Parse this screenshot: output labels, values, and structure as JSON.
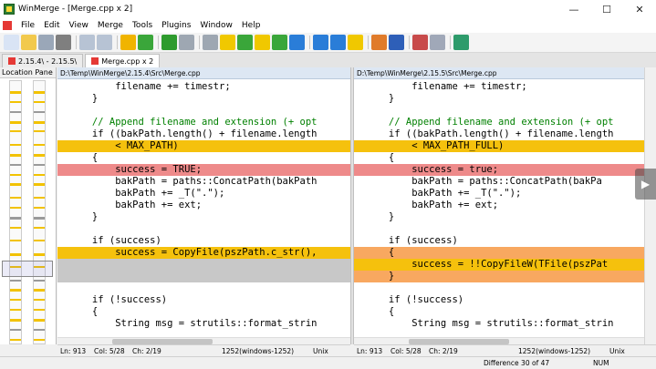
{
  "window": {
    "title": "WinMerge - [Merge.cpp x 2]",
    "minimize": "—",
    "maximize": "☐",
    "close": "✕"
  },
  "menu": [
    "File",
    "Edit",
    "View",
    "Merge",
    "Tools",
    "Plugins",
    "Window",
    "Help"
  ],
  "toolbar": {
    "colors": [
      "#d9e4f5",
      "#f2c94c",
      "#9aa7b8",
      "#7f7f7f",
      "#b7c3d4",
      "#b7c3d4",
      "#f0b400",
      "#3aa63a",
      "#2e9b2e",
      "#9ea7b2",
      "#9ea7b2",
      "#f0c800",
      "#3aa63a",
      "#f0c800",
      "#3aa63a",
      "#2a7dd8",
      "#2a7dd8",
      "#2a7dd8",
      "#f0c800",
      "#e07b2a",
      "#2e5fb8",
      "#c84b4b",
      "#a0a8b8",
      "#2e9b6b"
    ]
  },
  "tabs": [
    {
      "label": "2.15.4\\ - 2.15.5\\",
      "active": false
    },
    {
      "label": "Merge.cpp x 2",
      "active": true
    }
  ],
  "location_pane": {
    "title": "Location Pane"
  },
  "left": {
    "path": "D:\\Temp\\WinMerge\\2.15.4\\Src\\Merge.cpp",
    "lines": [
      {
        "text": "          filename += timestr;",
        "bg": "#ffffff"
      },
      {
        "text": "      }",
        "bg": "#ffffff"
      },
      {
        "text": "",
        "bg": "#ffffff"
      },
      {
        "text": "      // Append filename and extension (+ opt",
        "bg": "#ffffff",
        "cls": "cm"
      },
      {
        "text": "      if ((bakPath.length() + filename.length",
        "bg": "#ffffff"
      },
      {
        "text": "          < MAX_PATH)",
        "bg": "#f5c10d"
      },
      {
        "text": "      {",
        "bg": "#ffffff"
      },
      {
        "text": "          success = TRUE;",
        "bg": "#ee8a8a"
      },
      {
        "text": "          bakPath = paths::ConcatPath(bakPath",
        "bg": "#ffffff"
      },
      {
        "text": "          bakPath += _T(\".\");",
        "bg": "#ffffff"
      },
      {
        "text": "          bakPath += ext;",
        "bg": "#ffffff"
      },
      {
        "text": "      }",
        "bg": "#ffffff"
      },
      {
        "text": "",
        "bg": "#ffffff"
      },
      {
        "text": "      if (success)",
        "bg": "#ffffff"
      },
      {
        "text": "          success = CopyFile(pszPath.c_str(),",
        "bg": "#f5c10d"
      },
      {
        "text": "",
        "bg": "#c8c8c8"
      },
      {
        "text": "",
        "bg": "#c8c8c8"
      },
      {
        "text": "",
        "bg": "#ffffff"
      },
      {
        "text": "      if (!success)",
        "bg": "#ffffff"
      },
      {
        "text": "      {",
        "bg": "#ffffff"
      },
      {
        "text": "          String msg = strutils::format_strin",
        "bg": "#ffffff"
      },
      {
        "text": "",
        "bg": "#ffffff"
      }
    ]
  },
  "right": {
    "path": "D:\\Temp\\WinMerge\\2.15.5\\Src\\Merge.cpp",
    "lines": [
      {
        "text": "          filename += timestr;",
        "bg": "#ffffff"
      },
      {
        "text": "      }",
        "bg": "#ffffff"
      },
      {
        "text": "",
        "bg": "#ffffff"
      },
      {
        "text": "      // Append filename and extension (+ opt",
        "bg": "#ffffff",
        "cls": "cm"
      },
      {
        "text": "      if ((bakPath.length() + filename.length",
        "bg": "#ffffff"
      },
      {
        "text": "          < MAX_PATH_FULL)",
        "bg": "#f5c10d"
      },
      {
        "text": "      {",
        "bg": "#ffffff"
      },
      {
        "text": "          success = true;",
        "bg": "#ee8a8a"
      },
      {
        "text": "          bakPath = paths::ConcatPath(bakPa",
        "bg": "#ffffff"
      },
      {
        "text": "          bakPath += _T(\".\");",
        "bg": "#ffffff"
      },
      {
        "text": "          bakPath += ext;",
        "bg": "#ffffff"
      },
      {
        "text": "      }",
        "bg": "#ffffff"
      },
      {
        "text": "",
        "bg": "#ffffff"
      },
      {
        "text": "      if (success)",
        "bg": "#ffffff"
      },
      {
        "text": "      {",
        "bg": "#f8a860"
      },
      {
        "text": "          success = !!CopyFileW(TFile(pszPat",
        "bg": "#f5c10d"
      },
      {
        "text": "      }",
        "bg": "#f8a860"
      },
      {
        "text": "",
        "bg": "#ffffff"
      },
      {
        "text": "      if (!success)",
        "bg": "#ffffff"
      },
      {
        "text": "      {",
        "bg": "#ffffff"
      },
      {
        "text": "          String msg = strutils::format_strin",
        "bg": "#ffffff"
      },
      {
        "text": "",
        "bg": "#ffffff"
      }
    ]
  },
  "status_left": {
    "ln": "Ln: 913",
    "col": "Col: 5/28",
    "ch": "Ch: 2/19",
    "enc": "1252(windows-1252)",
    "eol": "Unix"
  },
  "status_right": {
    "ln": "Ln: 913",
    "col": "Col: 5/28",
    "ch": "Ch: 2/19",
    "enc": "1252(windows-1252)",
    "eol": "Unix"
  },
  "statusbar": {
    "difference": "Difference 30 of 47",
    "num": "NUM"
  }
}
